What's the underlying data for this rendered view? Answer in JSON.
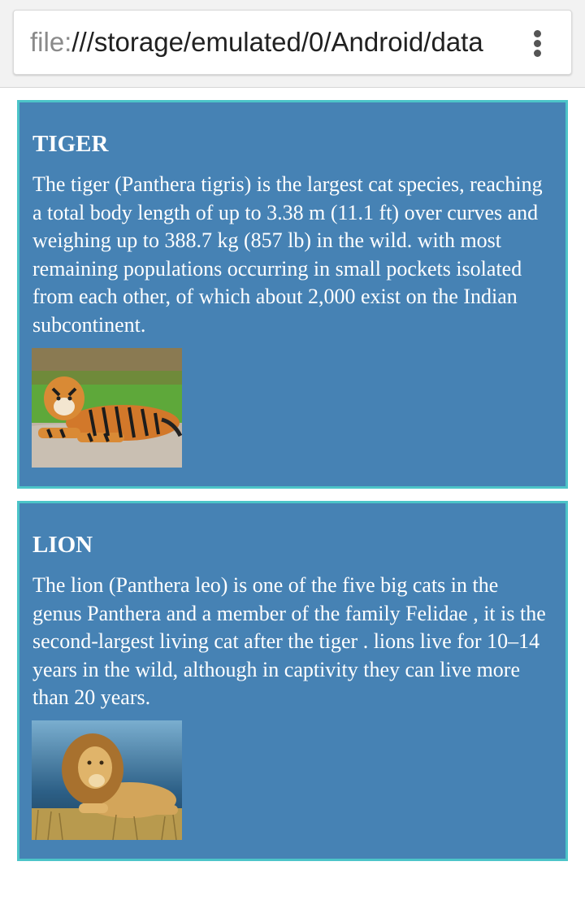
{
  "browser": {
    "url_scheme": "file:",
    "url_rest": "///storage/emulated/0/Android/data",
    "menu_icon": "more-vert-icon"
  },
  "cards": [
    {
      "title": "TIGER",
      "body": "The tiger (Panthera tigris) is the largest cat species, reaching a total body length of up to 3.38 m (11.1 ft) over curves and weighing up to 388.7 kg (857 lb) in the wild. with most remaining populations occurring in small pockets isolated from each other, of which about 2,000 exist on the Indian subcontinent."
    },
    {
      "title": "LION",
      "body": "The lion (Panthera leo) is one of the five big cats in the genus Panthera and a member of the family Felidae , it is the second-largest living cat after the tiger . lions live for 10–14 years in the wild, although in captivity they can live more than 20 years."
    }
  ],
  "colors": {
    "card_background": "#4682b4",
    "card_border": "#4cc4c8",
    "card_text": "#ffffff"
  }
}
